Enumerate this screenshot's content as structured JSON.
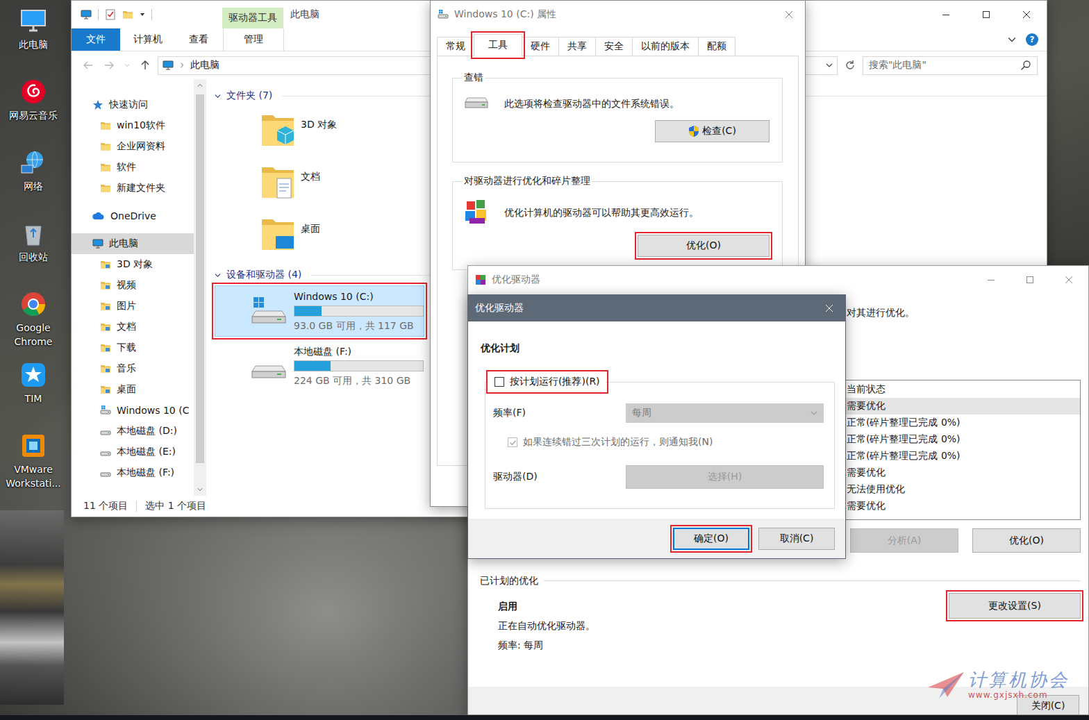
{
  "desktop": {
    "icons": [
      {
        "label": "此电脑",
        "kind": "pc"
      },
      {
        "label": "网易云音乐",
        "kind": "music"
      },
      {
        "label": "网络",
        "kind": "network"
      },
      {
        "label": "回收站",
        "kind": "recycle"
      },
      {
        "label": "Google Chrome",
        "kind": "chrome"
      },
      {
        "label": "TIM",
        "kind": "tim"
      },
      {
        "label": "VMware Workstati...",
        "kind": "vmware"
      }
    ]
  },
  "explorer": {
    "title": "此电脑",
    "context_tab": "驱动器工具",
    "ribbon_tabs": [
      {
        "label": "文件",
        "selected": false,
        "kind": "file"
      },
      {
        "label": "计算机",
        "selected": false,
        "kind": "tab"
      },
      {
        "label": "查看",
        "selected": false,
        "kind": "tab"
      },
      {
        "label": "管理",
        "selected": false,
        "kind": "context"
      }
    ],
    "help": "?",
    "address": {
      "path": "此电脑"
    },
    "search": {
      "placeholder": "搜索\"此电脑\""
    },
    "nav": [
      {
        "label": "快速访问",
        "kind": "quick",
        "selected": false
      },
      {
        "label": "win10软件",
        "kind": "folder",
        "selected": false
      },
      {
        "label": "企业网资料",
        "kind": "folder",
        "selected": false
      },
      {
        "label": "软件",
        "kind": "folder",
        "selected": false
      },
      {
        "label": "新建文件夹",
        "kind": "folder",
        "selected": false
      },
      {
        "label": "OneDrive",
        "kind": "cloud",
        "selected": false
      },
      {
        "label": "此电脑",
        "kind": "pc",
        "selected": true
      },
      {
        "label": "3D 对象",
        "kind": "library",
        "selected": false
      },
      {
        "label": "视频",
        "kind": "library",
        "selected": false
      },
      {
        "label": "图片",
        "kind": "library",
        "selected": false
      },
      {
        "label": "文档",
        "kind": "library",
        "selected": false
      },
      {
        "label": "下载",
        "kind": "library",
        "selected": false
      },
      {
        "label": "音乐",
        "kind": "library",
        "selected": false
      },
      {
        "label": "桌面",
        "kind": "library",
        "selected": false
      },
      {
        "label": "Windows 10 (C",
        "kind": "system",
        "selected": false
      },
      {
        "label": "本地磁盘 (D:)",
        "kind": "drive",
        "selected": false
      },
      {
        "label": "本地磁盘 (E:)",
        "kind": "drive",
        "selected": false
      },
      {
        "label": "本地磁盘 (F:)",
        "kind": "drive",
        "selected": false
      }
    ],
    "folders": {
      "title": "文件夹 (7)",
      "expanded": true,
      "items": [
        {
          "name": "3D 对象",
          "kind": "3d"
        },
        {
          "name": "文档",
          "kind": "docs"
        },
        {
          "name": "桌面",
          "kind": "desktop"
        }
      ]
    },
    "drives": {
      "title": "设备和驱动器 (4)",
      "expanded": true,
      "items": [
        {
          "name": "Windows 10 (C:)",
          "free": "93.0 GB 可用，共 117 GB",
          "level": 0.21,
          "selected": true,
          "highlighted": true,
          "kind": "system"
        },
        {
          "name": "本地磁盘 (F:)",
          "free": "224 GB 可用，共 310 GB",
          "level": 0.28,
          "selected": false,
          "highlighted": false,
          "kind": "local"
        }
      ]
    },
    "status_bar": [
      "11 个项目",
      "选中 1 个项目"
    ]
  },
  "properties": {
    "title": "Windows 10 (C:) 属性",
    "tabs": [
      {
        "label": "常规",
        "selected": false,
        "highlighted": false
      },
      {
        "label": "工具",
        "selected": true,
        "highlighted": true
      },
      {
        "label": "硬件",
        "selected": false,
        "highlighted": false
      },
      {
        "label": "共享",
        "selected": false,
        "highlighted": false
      },
      {
        "label": "安全",
        "selected": false,
        "highlighted": false
      },
      {
        "label": "以前的版本",
        "selected": false,
        "highlighted": false
      },
      {
        "label": "配额",
        "selected": false,
        "highlighted": false
      }
    ],
    "groups": [
      {
        "title": "查错",
        "text": "此选项将检查驱动器中的文件系统错误。",
        "kind": "check",
        "button": {
          "label": "检查(C)",
          "highlighted": false
        }
      },
      {
        "title": "对驱动器进行优化和碎片整理",
        "text": "优化计算机的驱动器可以帮助其更高效运行。",
        "kind": "optimize",
        "button": {
          "label": "优化(O)",
          "highlighted": true
        }
      }
    ]
  },
  "optimizer": {
    "title": "优化驱动器",
    "intro": "对其进行优化。",
    "list": {
      "column": "当前状态",
      "rows": [
        {
          "status": "需要优化",
          "selected": true
        },
        {
          "status": "正常(碎片整理已完成 0%)",
          "selected": false
        },
        {
          "status": "正常(碎片整理已完成 0%)",
          "selected": false
        },
        {
          "status": "正常(碎片整理已完成 0%)",
          "selected": false
        },
        {
          "status": "需要优化",
          "selected": false
        },
        {
          "status": "无法使用优化",
          "selected": false
        },
        {
          "status": "需要优化",
          "selected": false
        }
      ]
    },
    "buttons": [
      {
        "label": "分析(A)",
        "disabled": true
      },
      {
        "label": "优化(O)",
        "disabled": false
      }
    ],
    "schedule": {
      "title": "已计划的优化",
      "state": "启用",
      "text": "正在自动优化驱动器。",
      "frequency": "频率: 每周",
      "button": {
        "label": "更改设置(S)",
        "highlighted": true
      }
    },
    "close": "关闭(C)"
  },
  "dialog": {
    "title": "优化驱动器",
    "heading": "优化计划",
    "schedule": {
      "label": "按计划运行(推荐)(R)",
      "checked": false,
      "highlighted": true
    },
    "frequency": {
      "label": "频率(F)",
      "value": "每周",
      "disabled": true
    },
    "notify": {
      "label": "如果连续错过三次计划的运行，则通知我(N)",
      "checked": true,
      "disabled": true
    },
    "drives": {
      "label": "驱动器(D)",
      "button": "选择(H)",
      "disabled": true
    },
    "buttons": [
      {
        "label": "确定(O)",
        "highlighted": true,
        "default": true
      },
      {
        "label": "取消(C)",
        "highlighted": false,
        "default": false
      }
    ]
  },
  "watermark": {
    "title": "计算机协会",
    "url": "www.gxjsxh.com"
  }
}
